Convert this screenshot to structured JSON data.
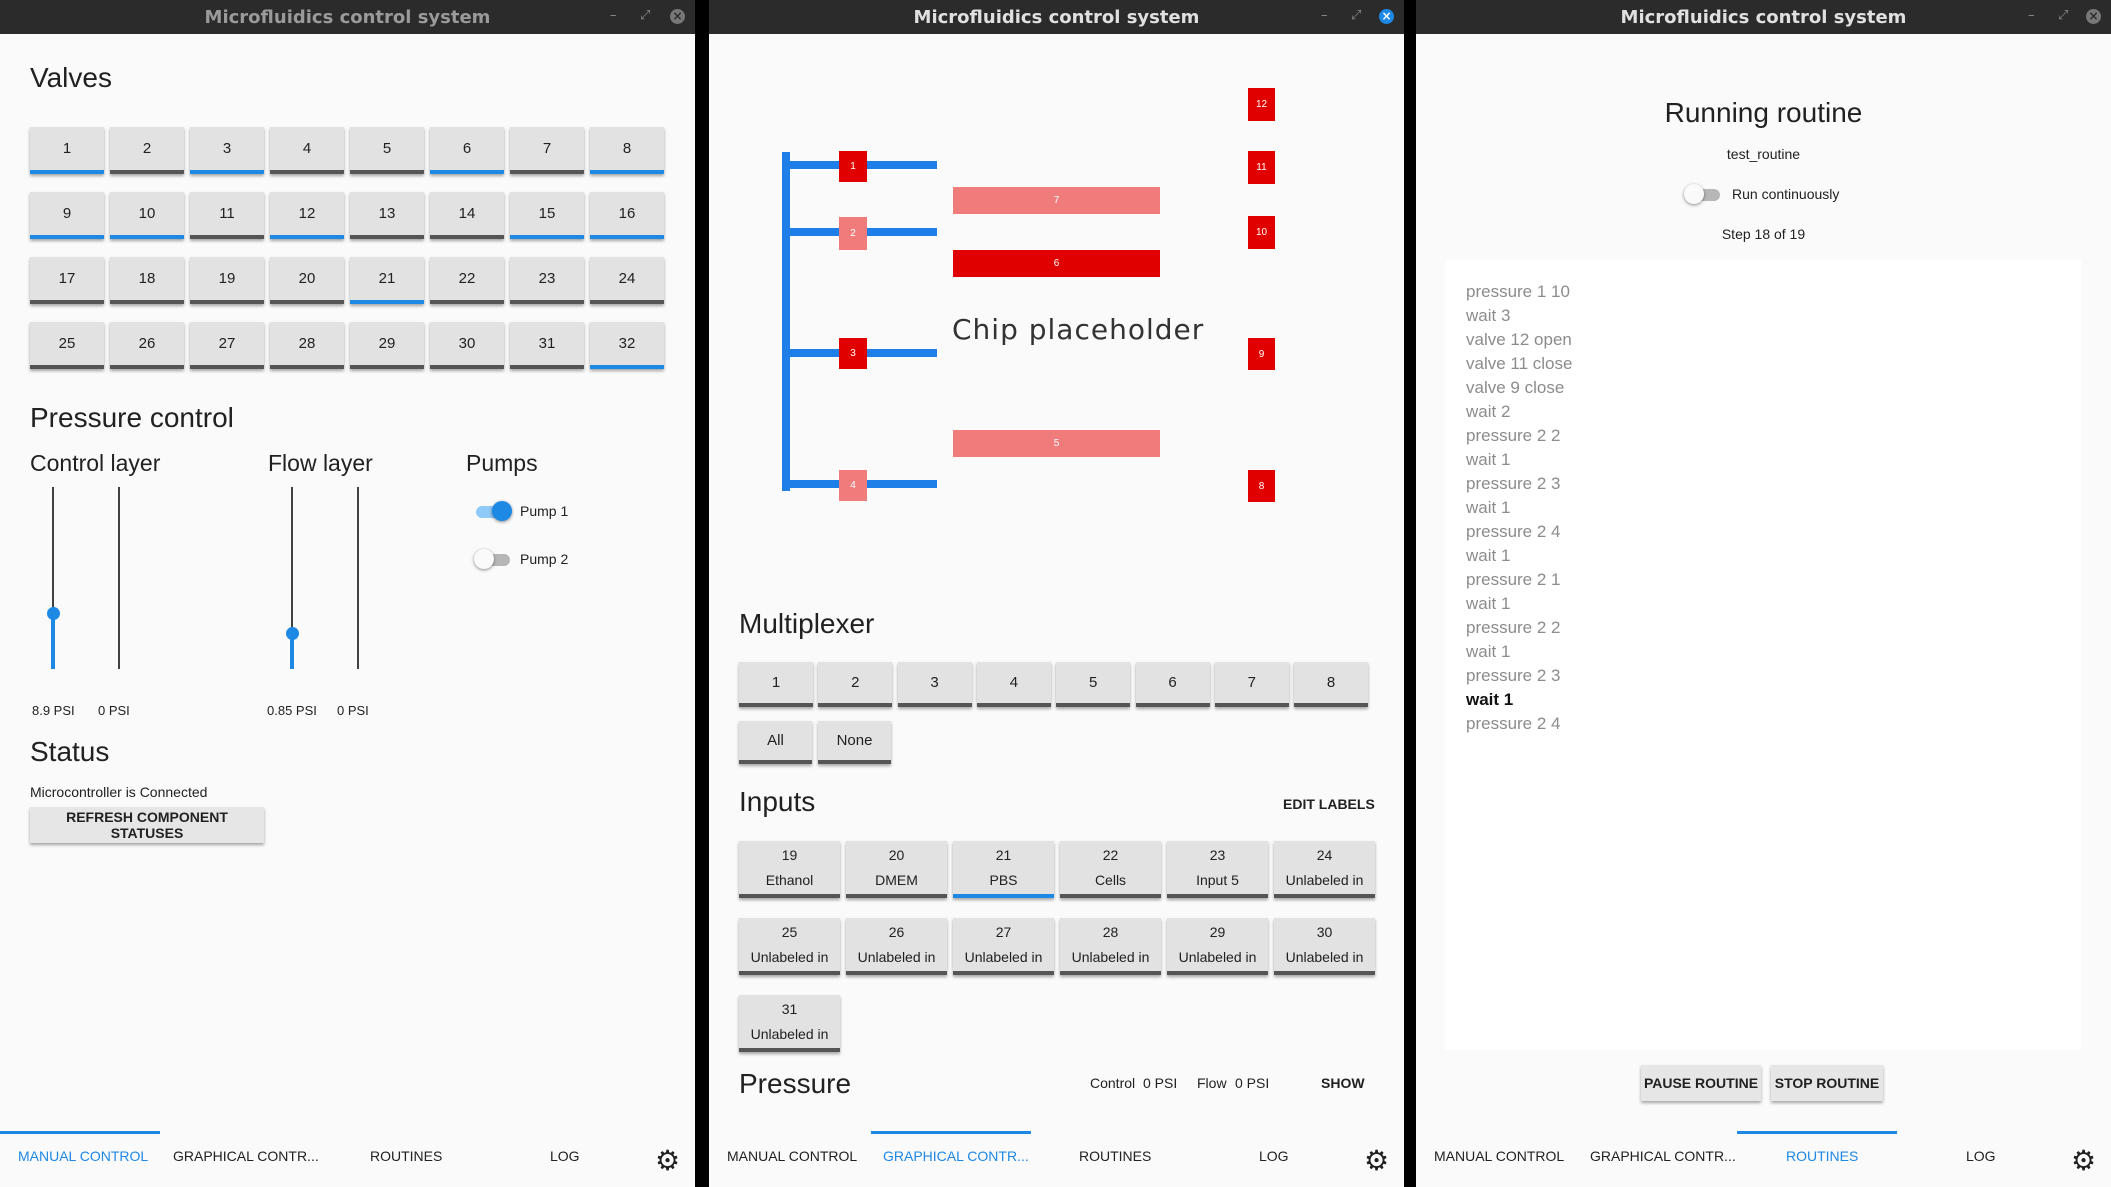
{
  "app_title": "Microfluidics control system",
  "tabs": [
    "MANUAL CONTROL",
    "GRAPHICAL CONTR...",
    "ROUTINES",
    "LOG"
  ],
  "manual": {
    "valves_title": "Valves",
    "valves": [
      {
        "label": "1",
        "on": true
      },
      {
        "label": "2",
        "on": false
      },
      {
        "label": "3",
        "on": true
      },
      {
        "label": "4",
        "on": false
      },
      {
        "label": "5",
        "on": false
      },
      {
        "label": "6",
        "on": true
      },
      {
        "label": "7",
        "on": false
      },
      {
        "label": "8",
        "on": true
      },
      {
        "label": "9",
        "on": true
      },
      {
        "label": "10",
        "on": true
      },
      {
        "label": "11",
        "on": false
      },
      {
        "label": "12",
        "on": true
      },
      {
        "label": "13",
        "on": false
      },
      {
        "label": "14",
        "on": false
      },
      {
        "label": "15",
        "on": true
      },
      {
        "label": "16",
        "on": true
      },
      {
        "label": "17",
        "on": false
      },
      {
        "label": "18",
        "on": false
      },
      {
        "label": "19",
        "on": false
      },
      {
        "label": "20",
        "on": false
      },
      {
        "label": "21",
        "on": true
      },
      {
        "label": "22",
        "on": false
      },
      {
        "label": "23",
        "on": false
      },
      {
        "label": "24",
        "on": false
      },
      {
        "label": "25",
        "on": false
      },
      {
        "label": "26",
        "on": false
      },
      {
        "label": "27",
        "on": false
      },
      {
        "label": "28",
        "on": false
      },
      {
        "label": "29",
        "on": false
      },
      {
        "label": "30",
        "on": false
      },
      {
        "label": "31",
        "on": false
      },
      {
        "label": "32",
        "on": true
      }
    ],
    "pressure_title": "Pressure control",
    "control_layer": "Control layer",
    "flow_layer": "Flow layer",
    "pumps_title": "Pumps",
    "sliders": [
      {
        "value_label": "8.9 PSI",
        "level": 0.31
      },
      {
        "value_label": "0 PSI",
        "level": 0
      },
      {
        "value_label": "0.85 PSI",
        "level": 0.2
      },
      {
        "value_label": "0 PSI",
        "level": 0
      }
    ],
    "pumps": [
      {
        "label": "Pump 1",
        "on": true
      },
      {
        "label": "Pump 2",
        "on": false
      }
    ],
    "status_title": "Status",
    "status_text": "Microcontroller is Connected",
    "refresh_button": "REFRESH COMPONENT STATUSES"
  },
  "graphical": {
    "chip_placeholder": "Chip placeholder",
    "chip_labels": [
      "1",
      "2",
      "3",
      "4",
      "5",
      "6",
      "7",
      "8",
      "9",
      "10",
      "11",
      "12"
    ],
    "multiplexer_title": "Multiplexer",
    "mux_buttons": [
      "1",
      "2",
      "3",
      "4",
      "5",
      "6",
      "7",
      "8"
    ],
    "mux_all": "All",
    "mux_none": "None",
    "inputs_title": "Inputs",
    "edit_labels": "EDIT LABELS",
    "inputs": [
      {
        "num": "19",
        "label": "Ethanol",
        "on": false
      },
      {
        "num": "20",
        "label": "DMEM",
        "on": false
      },
      {
        "num": "21",
        "label": "PBS",
        "on": true
      },
      {
        "num": "22",
        "label": "Cells",
        "on": false
      },
      {
        "num": "23",
        "label": "Input 5",
        "on": false
      },
      {
        "num": "24",
        "label": "Unlabeled in",
        "on": false
      },
      {
        "num": "25",
        "label": "Unlabeled in",
        "on": false
      },
      {
        "num": "26",
        "label": "Unlabeled in",
        "on": false
      },
      {
        "num": "27",
        "label": "Unlabeled in",
        "on": false
      },
      {
        "num": "28",
        "label": "Unlabeled in",
        "on": false
      },
      {
        "num": "29",
        "label": "Unlabeled in",
        "on": false
      },
      {
        "num": "30",
        "label": "Unlabeled in",
        "on": false
      },
      {
        "num": "31",
        "label": "Unlabeled in",
        "on": false
      }
    ],
    "pressure_title": "Pressure",
    "control_label": "Control",
    "control_value": "0 PSI",
    "flow_label": "Flow",
    "flow_value": "0 PSI",
    "show_button": "SHOW"
  },
  "routines": {
    "title": "Running routine",
    "routine_name": "test_routine",
    "run_continuously": "Run continuously",
    "run_continuously_on": false,
    "step_text": "Step 18 of 19",
    "steps": [
      "pressure 1 10",
      "wait 3",
      "valve 12 open",
      "valve 11 close",
      "valve 9 close",
      "wait 2",
      "pressure 2 2",
      "wait 1",
      "pressure 2 3",
      "wait 1",
      "pressure 2 4",
      "wait 1",
      "pressure 2 1",
      "wait 1",
      "pressure 2 2",
      "wait 1",
      "pressure 2 3",
      "wait 1",
      "pressure 2 4"
    ],
    "current_step": 18,
    "pause_button": "PAUSE ROUTINE",
    "stop_button": "STOP ROUTINE"
  },
  "colors": {
    "accent": "#1e88e5",
    "valve_closed": "#e00000",
    "valve_open": "#ef7b7b",
    "channel": "#1e7fe8"
  }
}
